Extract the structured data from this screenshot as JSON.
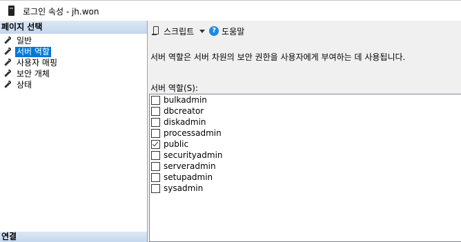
{
  "window": {
    "title": "로그인 속성 - jh.won",
    "icon": "sql-server-icon"
  },
  "left_pane": {
    "header": "페이지 선택",
    "pages": [
      {
        "label": "일반",
        "icon": "wrench-icon",
        "selected": false
      },
      {
        "label": "서버 역할",
        "icon": "wrench-icon",
        "selected": true
      },
      {
        "label": "사용자 매핑",
        "icon": "wrench-icon",
        "selected": false
      },
      {
        "label": "보안 개체",
        "icon": "wrench-icon",
        "selected": false
      },
      {
        "label": "상태",
        "icon": "wrench-icon",
        "selected": false
      }
    ],
    "connect_header": "연결"
  },
  "toolbar": {
    "script_label": "스크립트",
    "help_label": "도움말"
  },
  "content": {
    "description": "서버 역할은 서버 차원의 보안 권한을 사용자에게 부여하는 데 사용됩니다.",
    "roles_label": "서버 역할(S):",
    "roles": [
      {
        "name": "bulkadmin",
        "checked": false
      },
      {
        "name": "dbcreator",
        "checked": false
      },
      {
        "name": "diskadmin",
        "checked": false
      },
      {
        "name": "processadmin",
        "checked": false
      },
      {
        "name": "public",
        "checked": true
      },
      {
        "name": "securityadmin",
        "checked": false
      },
      {
        "name": "serveradmin",
        "checked": false
      },
      {
        "name": "setupadmin",
        "checked": false
      },
      {
        "name": "sysadmin",
        "checked": false
      }
    ]
  },
  "colors": {
    "selection": "#0078d7",
    "section_header": "#c4d7ee",
    "help_icon": "#1e88e5"
  }
}
